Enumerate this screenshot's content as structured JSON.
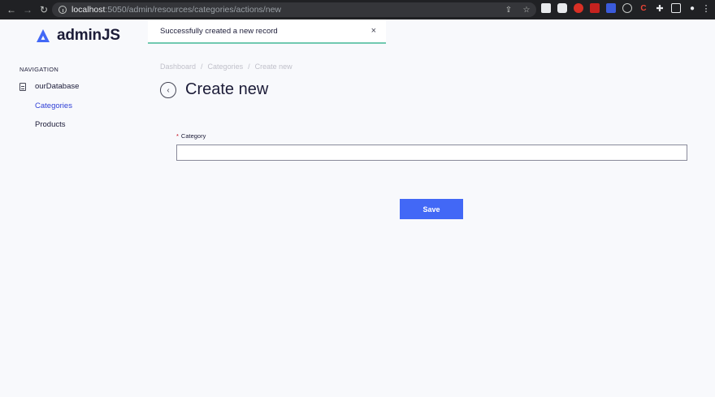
{
  "browser": {
    "url_host": "localhost",
    "url_path": ":5050/admin/resources/categories/actions/new"
  },
  "app": {
    "logo_text": "adminJS",
    "brand_color": "#4268f6"
  },
  "toast": {
    "message": "Successfully created a new record",
    "close": "×"
  },
  "sidebar": {
    "heading": "NAVIGATION",
    "database": "ourDatabase",
    "items": [
      {
        "label": "Categories",
        "active": true
      },
      {
        "label": "Products",
        "active": false
      }
    ]
  },
  "breadcrumbs": [
    "Dashboard",
    "/",
    "Categories",
    "/",
    "Create new"
  ],
  "page": {
    "title": "Create new",
    "back": "‹"
  },
  "form": {
    "required_mark": "*",
    "field_label": "Category",
    "field_value": "",
    "save_label": "Save"
  }
}
